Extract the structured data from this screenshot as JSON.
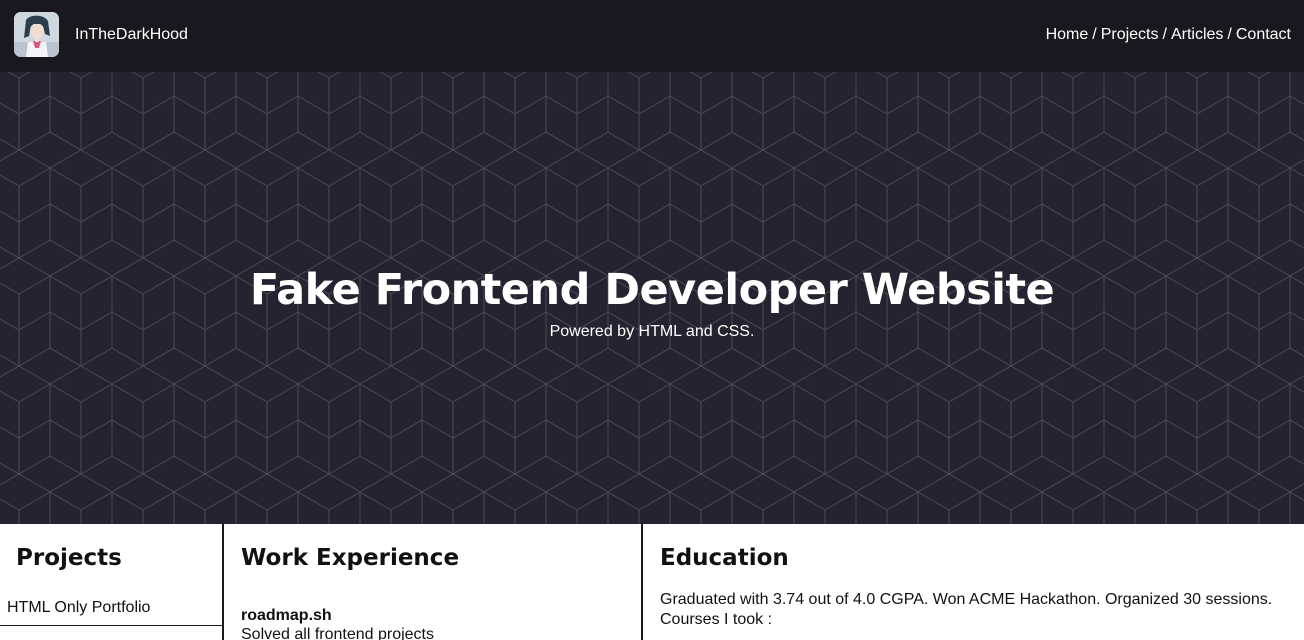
{
  "header": {
    "brand": "InTheDarkHood",
    "nav": [
      {
        "label": "Home"
      },
      {
        "label": "Projects"
      },
      {
        "label": "Articles"
      },
      {
        "label": "Contact"
      }
    ],
    "separator": "/"
  },
  "hero": {
    "title": "Fake Frontend Developer Website",
    "subtitle": "Powered by HTML and CSS.",
    "background_color": "#24232f",
    "pattern_color": "#4a4957"
  },
  "sections": {
    "projects": {
      "heading": "Projects",
      "items": [
        {
          "label": "HTML Only Portfolio"
        },
        {
          "label": ""
        }
      ]
    },
    "work": {
      "heading": "Work Experience",
      "job_title": "roadmap.sh",
      "job_desc": "Solved all frontend projects"
    },
    "education": {
      "heading": "Education",
      "line1": "Graduated with 3.74 out of 4.0 CGPA. Won ACME Hackathon. Organized 30 sessions.",
      "line2": "Courses I took :"
    }
  },
  "colors": {
    "header_bg": "#19181f",
    "text_dark": "#111111",
    "text_light": "#ffffff"
  }
}
